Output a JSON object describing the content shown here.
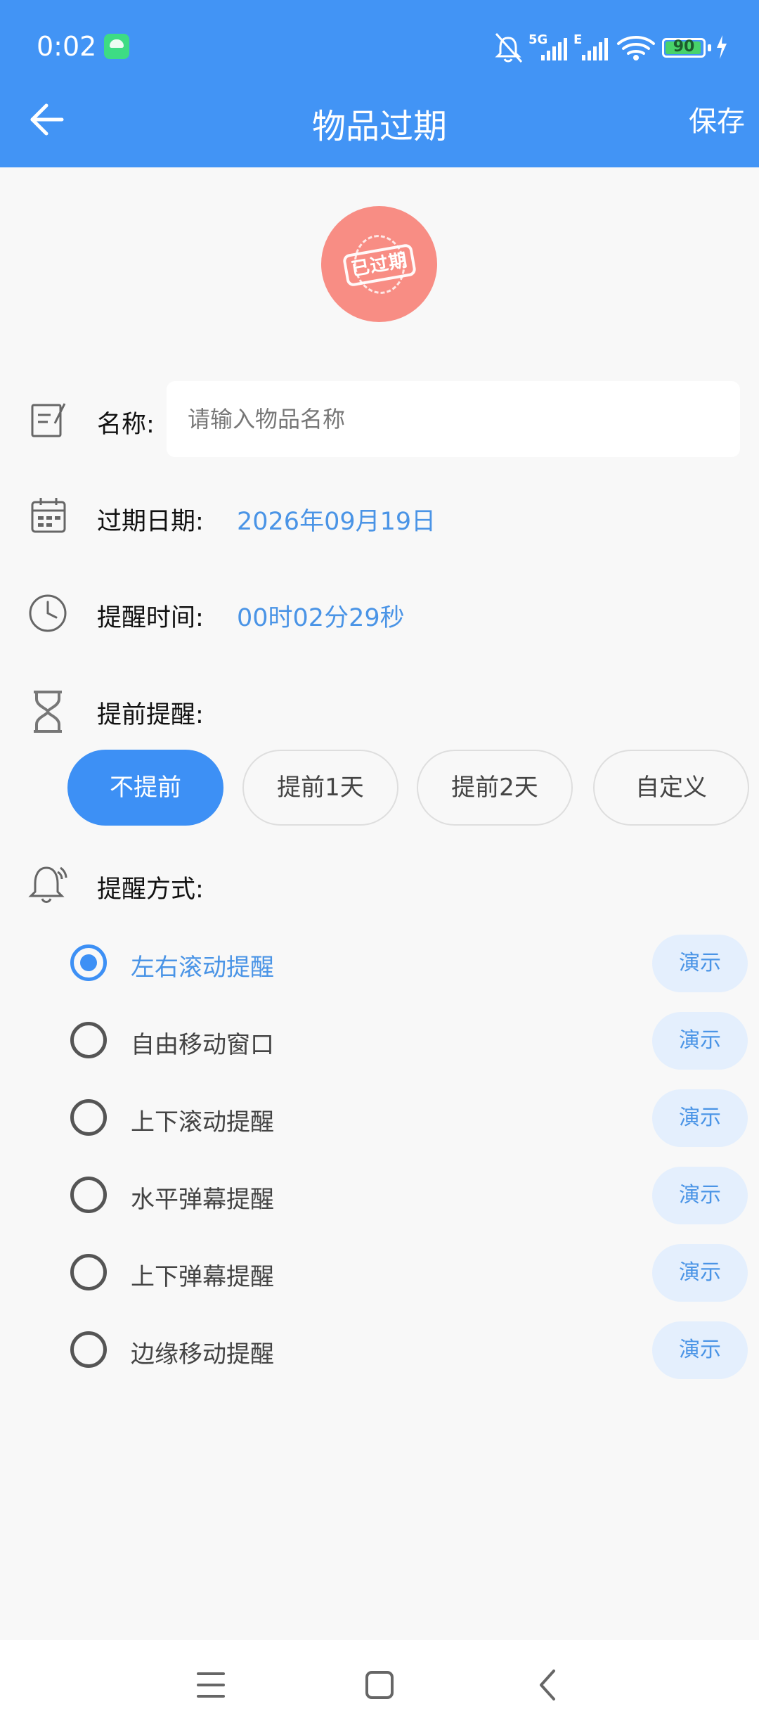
{
  "status_bar": {
    "time": "0:02",
    "battery": "90",
    "network_5g": "5G",
    "network_e": "E"
  },
  "header": {
    "title": "物品过期",
    "save_label": "保存"
  },
  "avatar": {
    "stamp_text": "已过期"
  },
  "form": {
    "name_label": "名称:",
    "name_placeholder": "请输入物品名称",
    "expire_label": "过期日期:",
    "expire_value": "2026年09月19日",
    "remind_time_label": "提醒时间:",
    "remind_time_value": "00时02分29秒",
    "advance_label": "提前提醒:",
    "advance_options": [
      {
        "label": "不提前",
        "selected": true
      },
      {
        "label": "提前1天",
        "selected": false
      },
      {
        "label": "提前2天",
        "selected": false
      },
      {
        "label": "自定义",
        "selected": false
      }
    ],
    "method_label": "提醒方式:",
    "methods": [
      {
        "label": "左右滚动提醒",
        "selected": true,
        "demo": "演示"
      },
      {
        "label": "自由移动窗口",
        "selected": false,
        "demo": "演示"
      },
      {
        "label": "上下滚动提醒",
        "selected": false,
        "demo": "演示"
      },
      {
        "label": "水平弹幕提醒",
        "selected": false,
        "demo": "演示"
      },
      {
        "label": "上下弹幕提醒",
        "selected": false,
        "demo": "演示"
      },
      {
        "label": "边缘移动提醒",
        "selected": false,
        "demo": "演示"
      }
    ]
  },
  "colors": {
    "primary": "#4294f5",
    "accent_text": "#4a94e6",
    "avatar_bg": "#f88d84",
    "demo_bg": "#e4effd"
  }
}
